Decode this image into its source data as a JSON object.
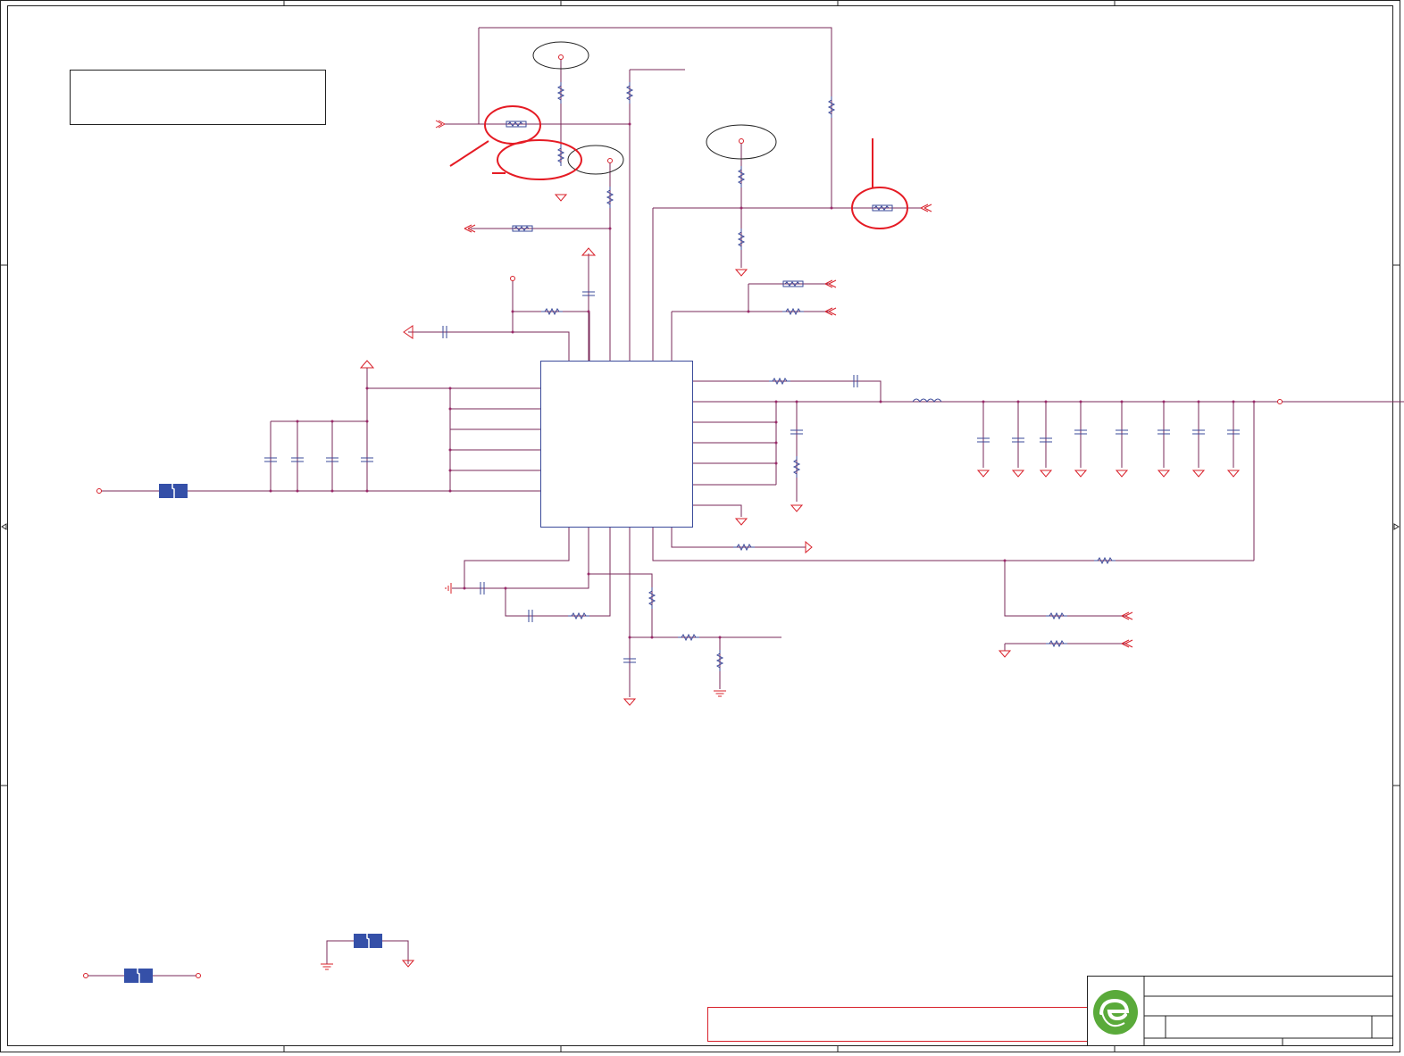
{
  "colors": {
    "wire": "#7a2a5a",
    "pin": "#d8202a",
    "component": "#3a4a9a",
    "highlight": "#e51b24",
    "ferrite_fill": "#3550a8",
    "logo_green": "#5aaa3a"
  }
}
